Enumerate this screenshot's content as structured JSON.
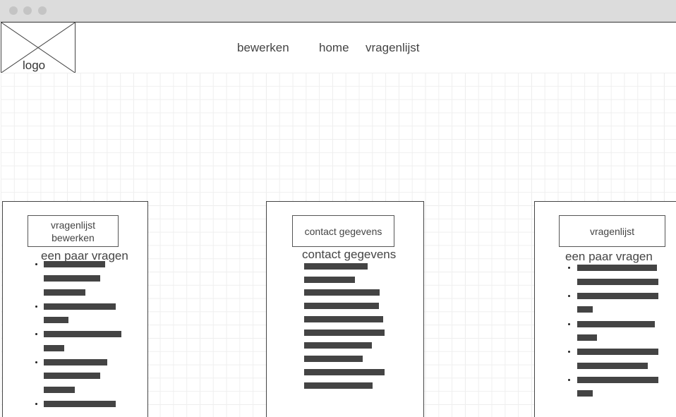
{
  "nav": {
    "logo_label": "logo",
    "links": [
      "bewerken",
      "home",
      "vragenlijst"
    ]
  },
  "panels": {
    "left": {
      "button_label_line1": "vragenlijst",
      "button_label_line2": "bewerken",
      "heading": "een paar vragen"
    },
    "middle": {
      "button_label": "contact gegevens",
      "heading": "contact gegevens"
    },
    "right": {
      "button_label": "vragenlijst",
      "heading": "een paar vragen"
    }
  },
  "colors": {
    "placeholder_bar": "#444444",
    "border": "#444444",
    "grid": "#efefef"
  }
}
